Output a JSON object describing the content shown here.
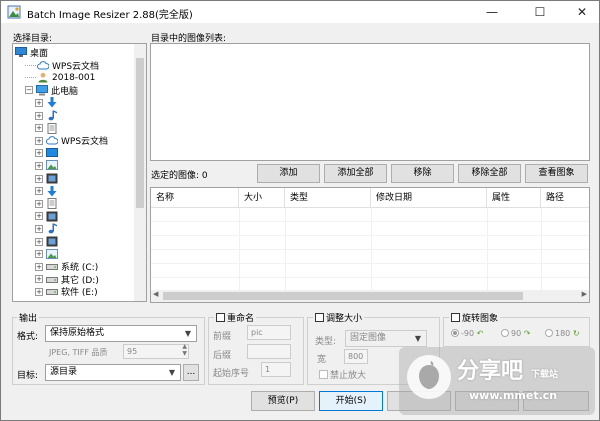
{
  "window": {
    "title": "Batch Image Resizer 2.88(完全版)",
    "minimize_glyph": "—",
    "maximize_glyph": "☐",
    "close_glyph": "✕"
  },
  "dir_tree": {
    "label": "选择目录:",
    "items": [
      {
        "label": "桌面",
        "icon": "desktop-icon",
        "expander": ""
      },
      {
        "label": "WPS云文档",
        "icon": "cloud-icon",
        "expander": ""
      },
      {
        "label": "2018-001",
        "icon": "user-icon",
        "expander": ""
      },
      {
        "label": "此电脑",
        "icon": "computer-icon",
        "expander": "−"
      },
      {
        "label": "",
        "icon": "download-arrow-icon",
        "expander": "+"
      },
      {
        "label": "",
        "icon": "music-note-icon",
        "expander": "+"
      },
      {
        "label": "",
        "icon": "document-icon",
        "expander": "+"
      },
      {
        "label": "WPS云文档",
        "icon": "cloud-icon",
        "expander": "+"
      },
      {
        "label": "",
        "icon": "monitor-icon",
        "expander": "+"
      },
      {
        "label": "",
        "icon": "picture-icon",
        "expander": "+"
      },
      {
        "label": "",
        "icon": "video-icon",
        "expander": "+"
      },
      {
        "label": "",
        "icon": "download-arrow-icon",
        "expander": "+"
      },
      {
        "label": "",
        "icon": "document-icon",
        "expander": "+"
      },
      {
        "label": "",
        "icon": "video-icon",
        "expander": "+"
      },
      {
        "label": "",
        "icon": "music-note-icon",
        "expander": "+"
      },
      {
        "label": "",
        "icon": "video-icon",
        "expander": "+"
      },
      {
        "label": "",
        "icon": "picture-icon",
        "expander": "+"
      },
      {
        "label": "系统 (C:)",
        "icon": "drive-icon",
        "expander": "+"
      },
      {
        "label": "其它 (D:)",
        "icon": "drive-icon",
        "expander": "+"
      },
      {
        "label": "软件 (E:)",
        "icon": "drive-icon",
        "expander": "+"
      }
    ]
  },
  "image_list": {
    "label": "目录中的图像列表:"
  },
  "selected": {
    "label": "选定的图像: 0",
    "buttons": {
      "add": "添加",
      "add_all": "添加全部",
      "remove": "移除",
      "remove_all": "移除全部",
      "view": "查看图象"
    },
    "columns": [
      "名称",
      "大小",
      "类型",
      "修改日期",
      "属性",
      "路径"
    ]
  },
  "output": {
    "group_label": "输出",
    "format_label": "格式:",
    "format_value": "保持原始格式",
    "quality_label": "JPEG, TIFF 品质",
    "quality_value": "95",
    "target_label": "目标:",
    "target_value": "源目录",
    "browse_label": "..."
  },
  "rename": {
    "label": "重命名",
    "prefix_label": "前缀",
    "prefix_value": "pic",
    "suffix_label": "后缀",
    "start_label": "起始序号",
    "start_value": "1"
  },
  "resize": {
    "label": "调整大小",
    "type_label": "类型:",
    "type_value": "固定图像",
    "width_label": "宽",
    "width_value": "800",
    "no_enlarge_label": "禁止放大"
  },
  "rotate": {
    "label": "旋转图象",
    "options": [
      "-90",
      "90",
      "180"
    ]
  },
  "actions": {
    "preview": "预览(P)",
    "start": "开始(S)"
  },
  "watermark": {
    "brand": "分享吧",
    "sub": "下载站",
    "url": "www.mmet.cn"
  }
}
